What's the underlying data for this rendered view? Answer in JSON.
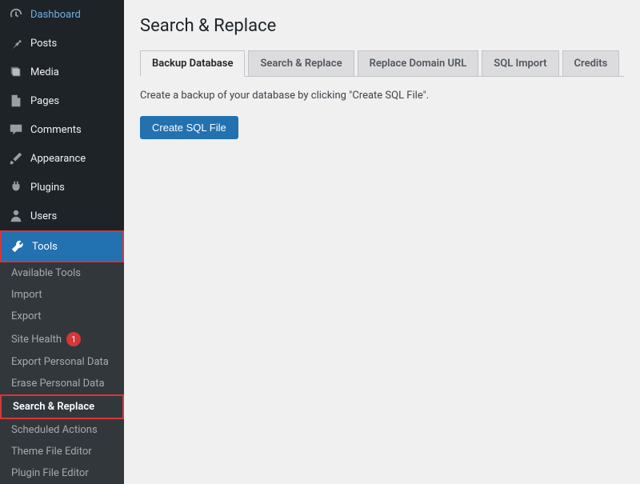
{
  "sidebar": {
    "items": [
      {
        "label": "Dashboard"
      },
      {
        "label": "Posts"
      },
      {
        "label": "Media"
      },
      {
        "label": "Pages"
      },
      {
        "label": "Comments"
      },
      {
        "label": "Appearance"
      },
      {
        "label": "Plugins"
      },
      {
        "label": "Users"
      },
      {
        "label": "Tools"
      }
    ],
    "submenu": [
      {
        "label": "Available Tools"
      },
      {
        "label": "Import"
      },
      {
        "label": "Export"
      },
      {
        "label": "Site Health",
        "badge": "1"
      },
      {
        "label": "Export Personal Data"
      },
      {
        "label": "Erase Personal Data"
      },
      {
        "label": "Search & Replace"
      },
      {
        "label": "Scheduled Actions"
      },
      {
        "label": "Theme File Editor"
      },
      {
        "label": "Plugin File Editor"
      }
    ]
  },
  "main": {
    "title": "Search & Replace",
    "tabs": [
      {
        "label": "Backup Database"
      },
      {
        "label": "Search & Replace"
      },
      {
        "label": "Replace Domain URL"
      },
      {
        "label": "SQL Import"
      },
      {
        "label": "Credits"
      }
    ],
    "description": "Create a backup of your database by clicking \"Create SQL File\".",
    "button": "Create SQL File"
  }
}
